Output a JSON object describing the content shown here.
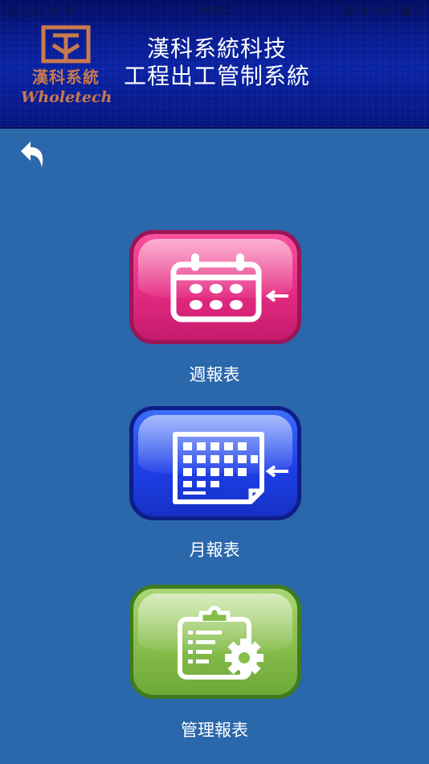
{
  "status_bar": {
    "carrier": "無 SIM 卡",
    "time": "09:22",
    "battery": "46%"
  },
  "header": {
    "logo_text": "漢科系統",
    "logo_script": "Wholetech",
    "title_line1": "漢科系統科技",
    "title_line2": "工程出工管制系統"
  },
  "menu": [
    {
      "label": "週報表"
    },
    {
      "label": "月報表"
    },
    {
      "label": "管理報表"
    }
  ],
  "colors": {
    "background": "#2a67ab",
    "weekly": "#e42a82",
    "monthly": "#1e3fe8",
    "manage": "#86bd4b"
  }
}
